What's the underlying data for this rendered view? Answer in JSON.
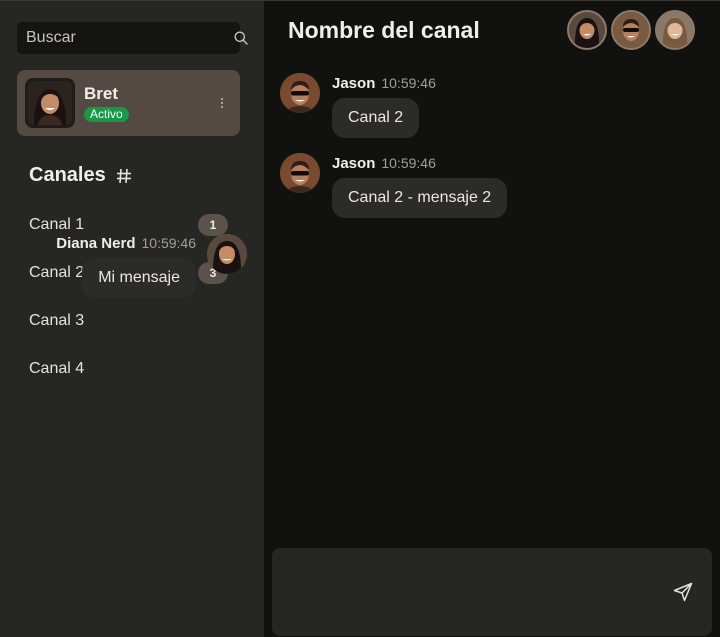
{
  "search": {
    "placeholder": "Buscar"
  },
  "user": {
    "name": "Bret",
    "status": "Activo"
  },
  "channels": {
    "title": "Canales",
    "items": [
      {
        "label": "Canal 1",
        "count": "1"
      },
      {
        "label": "Canal 2",
        "count": "3"
      },
      {
        "label": "Canal 3"
      },
      {
        "label": "Canal 4"
      }
    ]
  },
  "header": {
    "title": "Nombre del canal"
  },
  "messages": [
    {
      "author": "Jason",
      "time": "10:59:46",
      "text": "Canal 2"
    },
    {
      "author": "Jason",
      "time": "10:59:46",
      "text": "Canal 2 - mensaje 2"
    },
    {
      "author": "Diana Nerd",
      "time": "10:59:46",
      "text": "Mi mensaje"
    }
  ],
  "colors": {
    "sidebar_bg": "#262624",
    "main_bg": "#111210",
    "active_card": "#554a43",
    "status_green": "#179a45",
    "bubble_bg": "#2b2b29"
  },
  "icons": {
    "search": "search-icon",
    "more": "more-vertical-icon",
    "hash": "hash-icon",
    "send": "send-icon"
  }
}
